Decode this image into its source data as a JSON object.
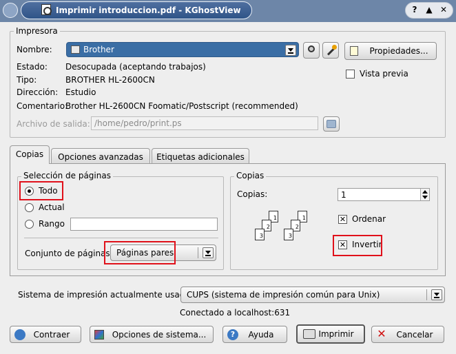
{
  "window": {
    "title": "Imprimir introduccion.pdf - KGhostView",
    "controls": [
      "?",
      "▲",
      "✕"
    ]
  },
  "printer": {
    "group_label": "Impresora",
    "name_label": "Nombre:",
    "name_value": "Brother",
    "state_label": "Estado:",
    "state_value": "Desocupada (aceptando trabajos)",
    "type_label": "Tipo:",
    "type_value": "BROTHER HL-2600CN",
    "address_label": "Dirección:",
    "address_value": "Estudio",
    "comment_label": "Comentario:",
    "comment_value": "Brother HL-2600CN Foomatic/Postscript (recommended)",
    "output_label": "Archivo de salida:",
    "output_value": "/home/pedro/print.ps",
    "properties_button": "Propiedades...",
    "preview_label": "Vista previa",
    "preview_checked": false
  },
  "tabs": [
    {
      "label": "Copias",
      "active": true
    },
    {
      "label": "Opciones avanzadas",
      "active": false
    },
    {
      "label": "Etiquetas adicionales",
      "active": false
    }
  ],
  "page_selection": {
    "group_label": "Selección de páginas",
    "all_label": "Todo",
    "current_label": "Actual",
    "range_label": "Rango",
    "range_value": "",
    "selected": "Todo",
    "set_label": "Conjunto de páginas:",
    "set_value": "Páginas pares"
  },
  "copies": {
    "group_label": "Copias",
    "count_label": "Copias:",
    "count_value": "1",
    "collate_label": "Ordenar",
    "collate_checked": true,
    "reverse_label": "Invertir",
    "reverse_checked": true,
    "collate_sheets": [
      "1",
      "2",
      "3"
    ]
  },
  "system": {
    "label": "Sistema de impresión actualmente usado:",
    "value": "CUPS (sistema de impresión común para Unix)",
    "connection": "Conectado a localhost:631"
  },
  "footer": {
    "collapse_button": "Contraer",
    "system_options_button": "Opciones de sistema...",
    "help_button": "Ayuda",
    "print_button": "Imprimir",
    "cancel_button": "Cancelar"
  },
  "colors": {
    "titlebar": "#6d86a8",
    "highlight": "#e0101a",
    "selection": "#3a6ea5"
  }
}
